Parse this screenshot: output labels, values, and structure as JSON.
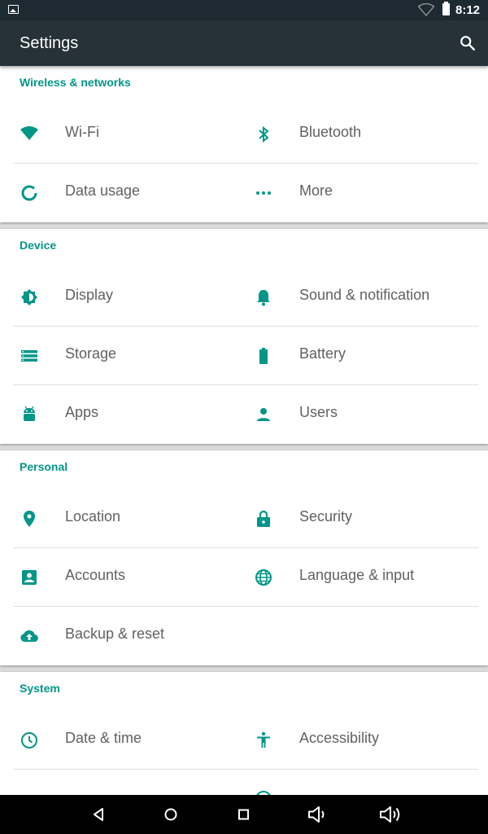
{
  "status": {
    "time": "8:12"
  },
  "header": {
    "title": "Settings",
    "search_icon": "search-icon"
  },
  "sections": [
    {
      "title": "Wireless & networks",
      "rows": [
        [
          {
            "label": "Wi-Fi",
            "icon": "wifi-icon"
          },
          {
            "label": "Bluetooth",
            "icon": "bluetooth-icon"
          }
        ],
        [
          {
            "label": "Data usage",
            "icon": "data-usage-icon"
          },
          {
            "label": "More",
            "icon": "more-icon"
          }
        ]
      ]
    },
    {
      "title": "Device",
      "rows": [
        [
          {
            "label": "Display",
            "icon": "display-icon"
          },
          {
            "label": "Sound & notification",
            "icon": "bell-icon"
          }
        ],
        [
          {
            "label": "Storage",
            "icon": "storage-icon"
          },
          {
            "label": "Battery",
            "icon": "battery-icon"
          }
        ],
        [
          {
            "label": "Apps",
            "icon": "android-icon"
          },
          {
            "label": "Users",
            "icon": "user-icon"
          }
        ]
      ]
    },
    {
      "title": "Personal",
      "rows": [
        [
          {
            "label": "Location",
            "icon": "location-icon"
          },
          {
            "label": "Security",
            "icon": "lock-icon"
          }
        ],
        [
          {
            "label": "Accounts",
            "icon": "account-icon"
          },
          {
            "label": "Language & input",
            "icon": "globe-icon"
          }
        ],
        [
          {
            "label": "Backup & reset",
            "icon": "cloud-upload-icon"
          }
        ]
      ]
    },
    {
      "title": "System",
      "rows": [
        [
          {
            "label": "Date & time",
            "icon": "clock-icon"
          },
          {
            "label": "Accessibility",
            "icon": "accessibility-icon"
          }
        ]
      ]
    }
  ],
  "colors": {
    "accent": "#009688",
    "appbar": "#263238",
    "statusbar": "#1d2a31",
    "text": "#616161"
  },
  "navbar": {
    "buttons": [
      "back-icon",
      "home-icon",
      "recents-icon",
      "volume-down-icon",
      "volume-up-icon"
    ]
  }
}
